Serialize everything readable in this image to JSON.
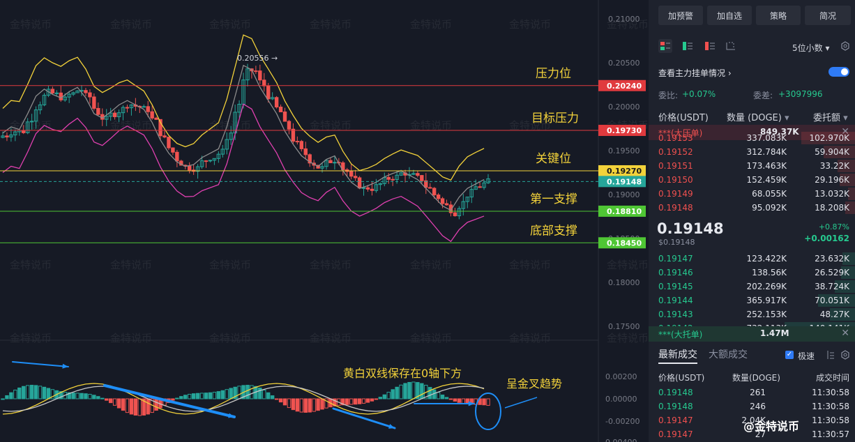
{
  "chart": {
    "price_labels": [
      "0.21000",
      "0.20500",
      "0.20000",
      "0.19500",
      "0.19000",
      "0.18500",
      "0.18000",
      "0.17500"
    ],
    "price_values": [
      0.21,
      0.205,
      0.2,
      0.195,
      0.19,
      0.185,
      0.18,
      0.175
    ],
    "macd_labels": [
      "0.00200",
      "0.00000",
      "-0.00200",
      "0.00400"
    ],
    "peak_label": "0.20556 →",
    "levels": [
      {
        "name": "压力位",
        "value": 0.2024,
        "tag": "0.20240",
        "color": "#e03a3e"
      },
      {
        "name": "目标压力",
        "value": 0.1973,
        "tag": "0.19730",
        "color": "#e03a3e"
      },
      {
        "name": "关键位",
        "value": 0.1927,
        "tag": "0.19270",
        "color": "#f3d23a"
      },
      {
        "name": "第一支撑",
        "value": 0.1881,
        "tag": "0.18810",
        "color": "#4fc634"
      },
      {
        "name": "底部支撑",
        "value": 0.1845,
        "tag": "0.18450",
        "color": "#4fc634"
      }
    ],
    "current": {
      "value": 0.19148,
      "tag": "0.19148",
      "color": "#26a69a"
    },
    "macd_annotation_1": "黄白双线保存在0轴下方",
    "macd_annotation_2": "呈金叉趋势",
    "watermark": "金特说币",
    "brand": "@金特说币"
  },
  "panel": {
    "buttons": [
      "加预警",
      "加自选",
      "策略",
      "简况"
    ],
    "decimals": "5位小数",
    "order_toggle_label": "查看主力挂单情况",
    "ratio_label": "委比:",
    "ratio_value": "+0.07%",
    "diff_label": "委差:",
    "diff_value": "+3097996",
    "col_price": "价格(USDT)",
    "col_qty": "数量 (DOGE)",
    "col_total": "委托额",
    "big_sell": {
      "label": "***(大压单)",
      "value": "849.37K"
    },
    "asks": [
      {
        "p": "0.19153",
        "q": "337.083K",
        "t": "102.970K",
        "w": 0.55
      },
      {
        "p": "0.19152",
        "q": "312.784K",
        "t": "59.904K",
        "w": 0.32
      },
      {
        "p": "0.19151",
        "q": "173.463K",
        "t": "33.22K",
        "w": 0.18
      },
      {
        "p": "0.19150",
        "q": "152.459K",
        "t": "29.196K",
        "w": 0.16
      },
      {
        "p": "0.19149",
        "q": "68.055K",
        "t": "13.032K",
        "w": 0.07
      },
      {
        "p": "0.19148",
        "q": "95.092K",
        "t": "18.208K",
        "w": 0.1
      }
    ],
    "last_price": "0.19148",
    "last_usd": "$0.19148",
    "change_pct": "+0.87%",
    "change_abs": "+0.00162",
    "bids": [
      {
        "p": "0.19147",
        "q": "123.422K",
        "t": "23.632K",
        "w": 0.13
      },
      {
        "p": "0.19146",
        "q": "138.56K",
        "t": "26.529K",
        "w": 0.14
      },
      {
        "p": "0.19145",
        "q": "202.269K",
        "t": "38.724K",
        "w": 0.21
      },
      {
        "p": "0.19144",
        "q": "365.917K",
        "t": "70.051K",
        "w": 0.38
      },
      {
        "p": "0.19143",
        "q": "252.153K",
        "t": "48.27K",
        "w": 0.26
      },
      {
        "p": "0.19142",
        "q": "732.113K",
        "t": "140.141K",
        "w": 0.72
      }
    ],
    "big_buy": {
      "label": "***(大托单)",
      "value": "1.47M"
    },
    "tab_latest": "最新成交",
    "tab_big": "大额成交",
    "speed_label": "极速",
    "trade_col_price": "价格(USDT)",
    "trade_col_qty": "数量(DOGE)",
    "trade_col_time": "成交时间",
    "trades": [
      {
        "p": "0.19148",
        "q": "261",
        "t": "11:30:58",
        "side": "buy"
      },
      {
        "p": "0.19148",
        "q": "246",
        "t": "11:30:58",
        "side": "buy"
      },
      {
        "p": "0.19147",
        "q": "2.04K",
        "t": "11:30:58",
        "side": "sell"
      },
      {
        "p": "0.19147",
        "q": "27",
        "t": "11:30:57",
        "side": "sell"
      }
    ]
  },
  "colors": {
    "up": "#26a69a",
    "down": "#ef5350",
    "bb_upper": "#f3d23a",
    "bb_mid": "#8c8c8c",
    "bb_lower": "#e040b0",
    "accent": "#2f7bf5"
  }
}
